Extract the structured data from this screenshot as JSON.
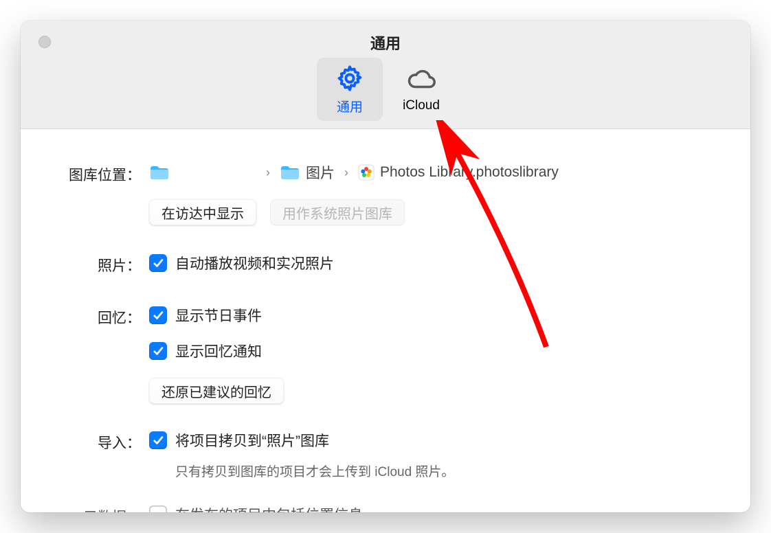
{
  "title": "通用",
  "tabs": {
    "general": "通用",
    "icloud": "iCloud"
  },
  "library": {
    "label": "图库位置：",
    "folder_pictures": "图片",
    "library_name": "Photos Library.photoslibrary",
    "show_in_finder": "在访达中显示",
    "use_as_system": "用作系统照片图库"
  },
  "photos": {
    "label": "照片：",
    "autoplay": "自动播放视频和实况照片"
  },
  "memories": {
    "label": "回忆：",
    "holiday": "显示节日事件",
    "notifications": "显示回忆通知",
    "reset": "还原已建议的回忆"
  },
  "import": {
    "label": "导入：",
    "copy": "将项目拷贝到“照片”图库",
    "note": "只有拷贝到图库的项目才会上传到 iCloud 照片。"
  },
  "metadata": {
    "label": "元数据：",
    "location_partial": "在发布的项目中包括位置信息"
  }
}
